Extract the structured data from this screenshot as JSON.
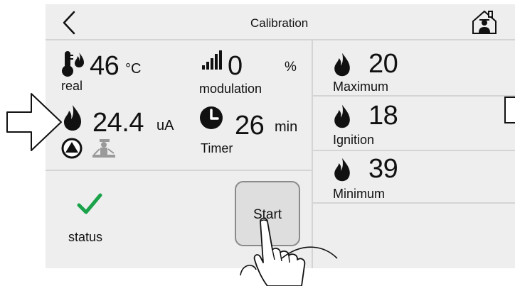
{
  "header": {
    "title": "Calibration",
    "back_icon": "chevron-left-icon",
    "home_icon": "home-icon"
  },
  "readings": {
    "temperature": {
      "value": "46",
      "unit": "°C",
      "label": "real",
      "icon": "thermometer-flame-icon"
    },
    "modulation": {
      "value": "0",
      "unit": "%",
      "label": "modulation",
      "icon": "signal-bars-icon"
    },
    "current": {
      "value": "24.4",
      "unit": "uA",
      "icon": "flame-icon"
    },
    "timer": {
      "value": "26",
      "unit": "min",
      "label": "Timer",
      "icon": "clock-icon"
    }
  },
  "status_icons": [
    "pump-icon",
    "chimney-sweep-icon"
  ],
  "levels": [
    {
      "value": "20",
      "label": "Maximum",
      "icon": "flame-icon"
    },
    {
      "value": "18",
      "label": "Ignition",
      "icon": "flame-icon"
    },
    {
      "value": "39",
      "label": "Minimum",
      "icon": "flame-icon"
    }
  ],
  "status": {
    "label": "status",
    "icon": "checkmark-icon",
    "color": "#1aa34a"
  },
  "start_button": {
    "label": "Start"
  },
  "overlay": {
    "arrow": "pointer-arrow-icon",
    "hand": "hand-pointer-icon"
  }
}
